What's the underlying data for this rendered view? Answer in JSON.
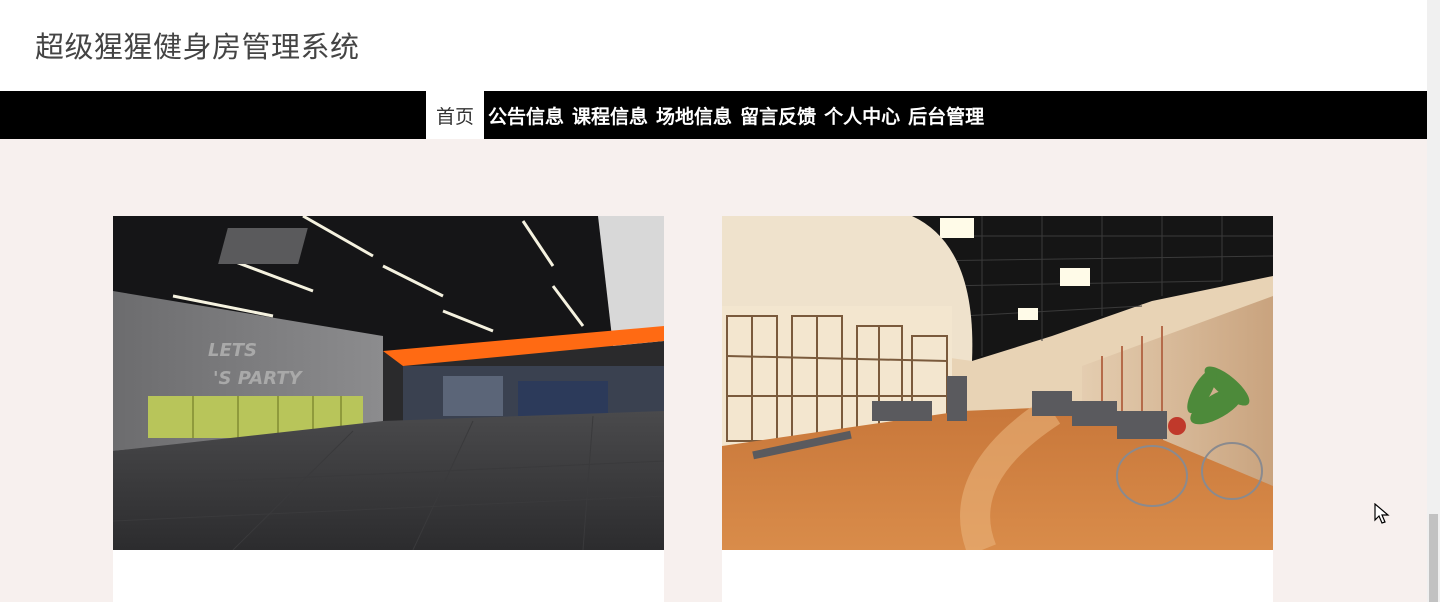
{
  "site": {
    "title": "超级猩猩健身房管理系统"
  },
  "nav": {
    "items": [
      {
        "label": "首页",
        "active": true
      },
      {
        "label": "公告信息"
      },
      {
        "label": "课程信息"
      },
      {
        "label": "场地信息"
      },
      {
        "label": "留言反馈"
      },
      {
        "label": "个人中心"
      },
      {
        "label": "后台管理"
      }
    ]
  },
  "gallery": {
    "cards": [
      {
        "image": "dark gym studio interior"
      },
      {
        "image": "bright gym with treadmills"
      }
    ]
  },
  "colors": {
    "navbar": "#000000",
    "page_background": "#f7f0ee",
    "accent_orange": "#ff6a13"
  }
}
